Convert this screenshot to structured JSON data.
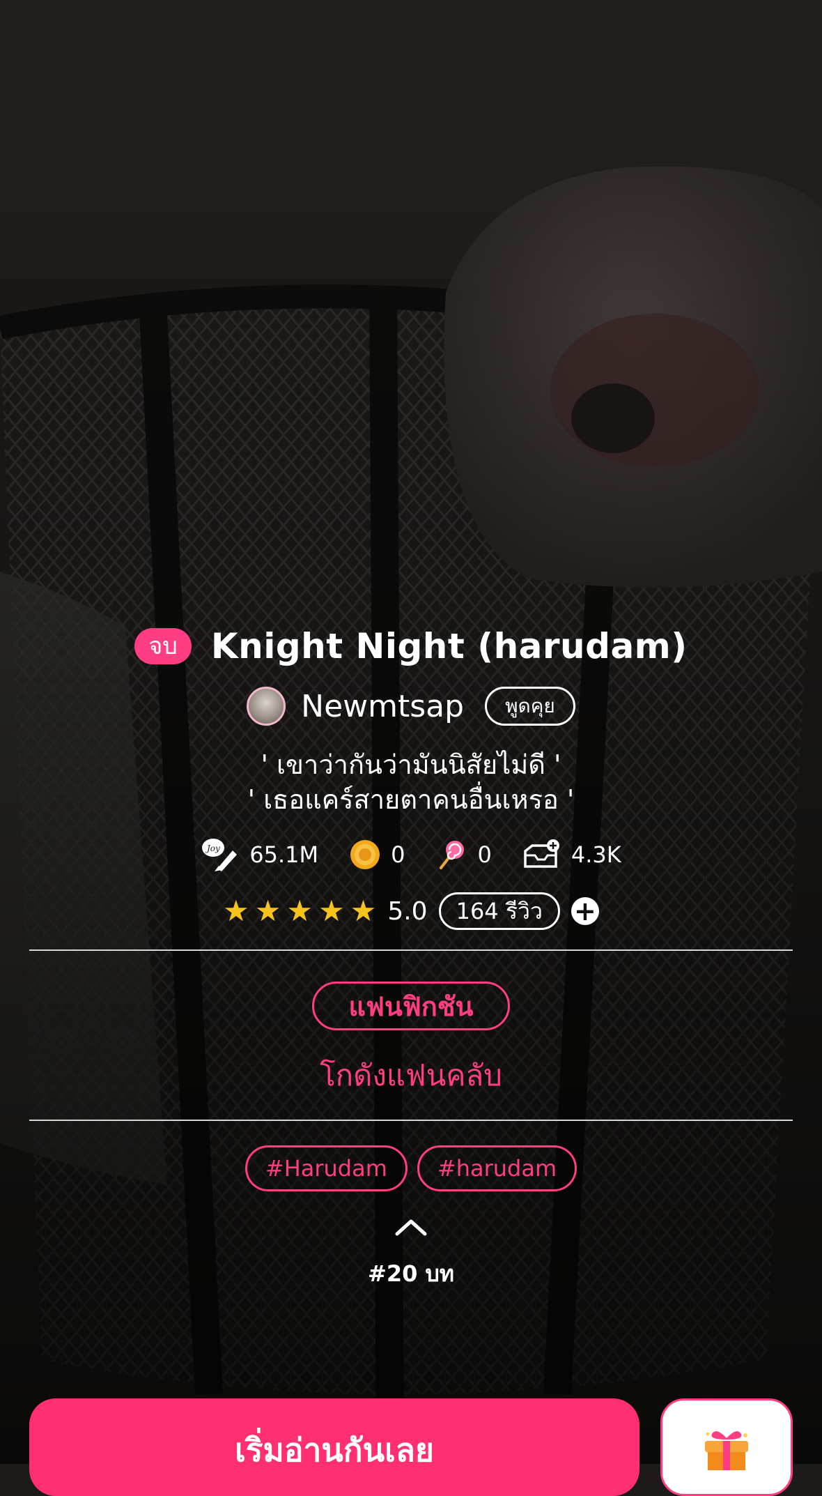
{
  "story": {
    "status": "จบ",
    "title": "Knight Night (harudam)",
    "author": "Newmtsap",
    "chat_label": "พูดคุย",
    "tagline_line1": "' เขาว่ากันว่ามันนิสัยไม่ดี '",
    "tagline_line2": "' เธอแคร์สายตาคนอื่นเหรอ '"
  },
  "stats": {
    "views": "65.1M",
    "coins": "0",
    "candies": "0",
    "library_adds": "4.3K"
  },
  "rating": {
    "stars": 5,
    "score": "5.0",
    "reviews_label": "164 รีวิว",
    "plus": "+"
  },
  "category": {
    "label": "แฟนฟิกชัน",
    "sublabel": "โกดังแฟนคลับ"
  },
  "tags": [
    "#Harudam",
    "#harudam"
  ],
  "chapters_label": "#20 บท",
  "actions": {
    "read_label": "เริ่มอ่านกันเลย"
  },
  "icons": {
    "views": "pen-quill-icon",
    "coins": "coin-icon",
    "candies": "lollipop-icon",
    "library": "add-to-shelf-icon",
    "expand": "chevron-up-icon",
    "gift": "gift-icon"
  },
  "colors": {
    "accent": "#ff3d82",
    "read_button": "#ff2f72",
    "star": "#f6c21c"
  }
}
